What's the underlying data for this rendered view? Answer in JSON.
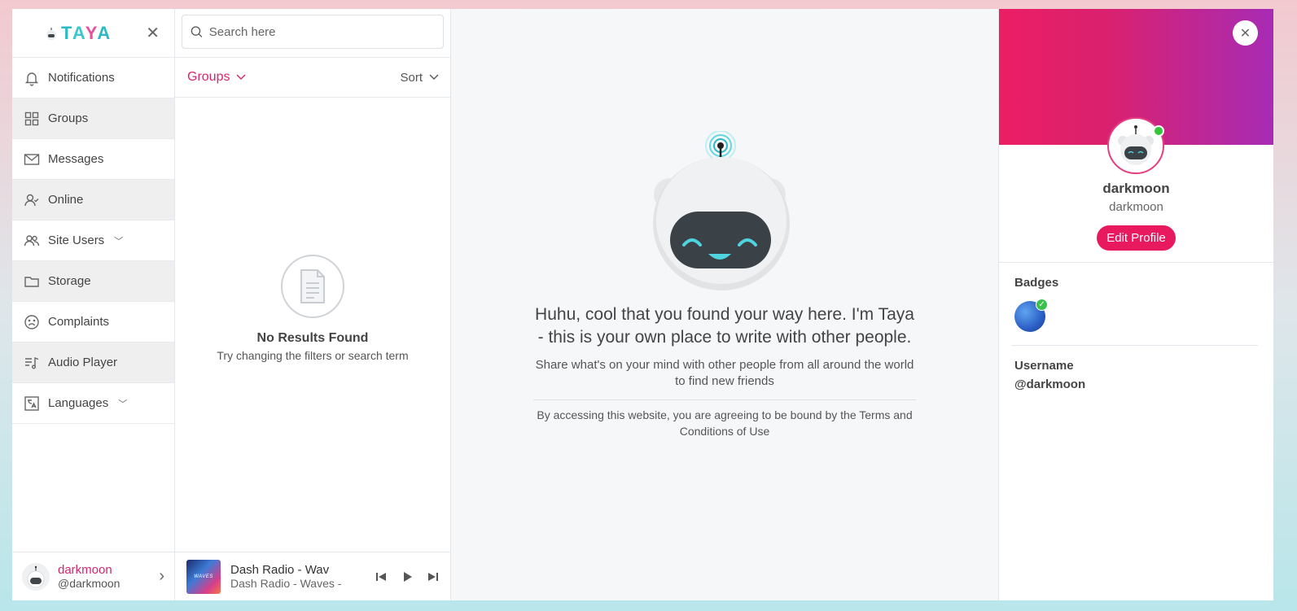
{
  "sidebar": {
    "logo_letters": [
      "T",
      "A",
      "Y",
      "A"
    ],
    "items": [
      {
        "label": "Notifications",
        "icon": "bell-icon"
      },
      {
        "label": "Groups",
        "icon": "grid-icon"
      },
      {
        "label": "Messages",
        "icon": "envelope-icon"
      },
      {
        "label": "Online",
        "icon": "user-check-icon"
      },
      {
        "label": "Site Users",
        "icon": "users-icon"
      },
      {
        "label": "Storage",
        "icon": "folder-icon"
      },
      {
        "label": "Complaints",
        "icon": "sad-face-icon"
      },
      {
        "label": "Audio Player",
        "icon": "playlist-icon"
      },
      {
        "label": "Languages",
        "icon": "translate-icon"
      }
    ],
    "user": {
      "name": "darkmoon",
      "handle": "@darkmoon"
    }
  },
  "list": {
    "search_placeholder": "Search here",
    "filter_label": "Groups",
    "sort_label": "Sort",
    "empty_title": "No Results Found",
    "empty_sub": "Try changing the filters or search term"
  },
  "player": {
    "cover_text": "WAVES",
    "title": "Dash Radio - Wav",
    "subtitle": "Dash Radio - Waves -"
  },
  "main": {
    "headline": "Huhu, cool that you found your way here. I'm Taya - this is your own place to write with other people.",
    "sub": "Share what's on your mind with other people from all around the world to find new friends",
    "terms": "By accessing this website, you are agreeing to be bound by the Terms and Conditions of Use"
  },
  "profile": {
    "name": "darkmoon",
    "display": "darkmoon",
    "edit_label": "Edit Profile",
    "badges_label": "Badges",
    "username_label": "Username",
    "username_value": "@darkmoon"
  },
  "colors": {
    "accent": "#e8195e",
    "brand_pink": "#d6256e",
    "teal": "#2bb9c6"
  }
}
